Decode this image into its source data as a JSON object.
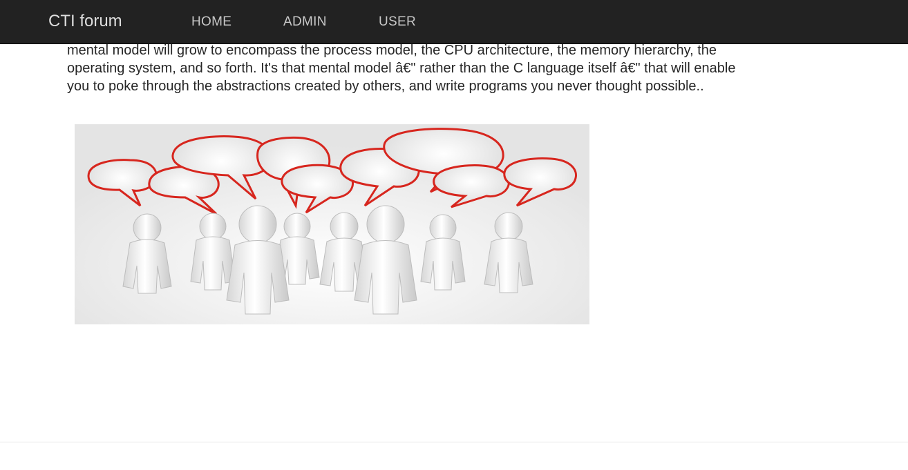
{
  "navbar": {
    "brand": "CTI forum",
    "links": [
      {
        "label": "HOME"
      },
      {
        "label": "ADMIN"
      },
      {
        "label": "USER"
      }
    ]
  },
  "main": {
    "paragraph": "mental model will grow to encompass the process model, the CPU architecture, the memory hierarchy, the operating system, and so forth. It's that mental model â€\" rather than the C language itself â€\" that will enable you to poke through the abstractions created by others, and write programs you never thought possible.."
  },
  "image": {
    "subject": "group-of-people-with-speech-bubbles",
    "bubble_color": "#d7261e",
    "figure_color": "#f2f2f2"
  }
}
